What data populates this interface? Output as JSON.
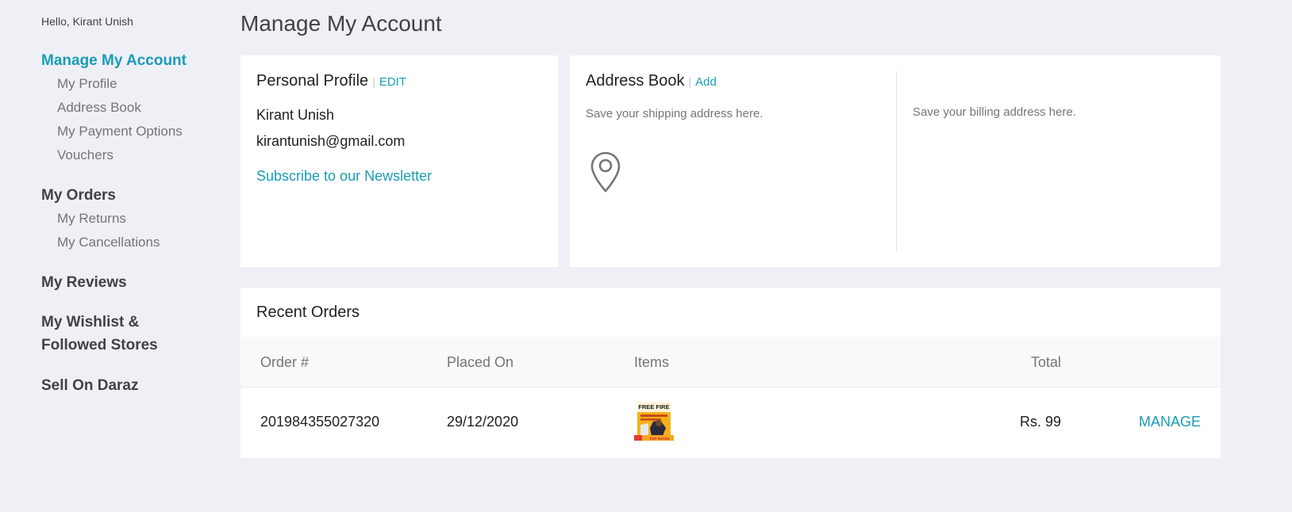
{
  "sidebar": {
    "greeting": "Hello, Kirant Unish",
    "groups": [
      {
        "label": "Manage My Account",
        "items": [
          "My Profile",
          "Address Book",
          "My Payment Options",
          "Vouchers"
        ]
      },
      {
        "label": "My Orders",
        "items": [
          "My Returns",
          "My Cancellations"
        ]
      },
      {
        "label": "My Reviews"
      },
      {
        "label": "My Wishlist &",
        "label2": "Followed Stores"
      },
      {
        "label": "Sell On Daraz"
      }
    ]
  },
  "page": {
    "title": "Manage My Account"
  },
  "profile": {
    "title": "Personal Profile",
    "edit_label": "EDIT",
    "name": "Kirant Unish",
    "email": "kirantunish@gmail.com",
    "newsletter_label": "Subscribe to our Newsletter"
  },
  "address_book": {
    "title": "Address Book",
    "add_label": "Add",
    "shipping_text": "Save your shipping address here.",
    "billing_text": "Save your billing address here.",
    "icon": "location-pin-icon"
  },
  "orders": {
    "title": "Recent Orders",
    "columns": [
      "Order #",
      "Placed On",
      "Items",
      "Total"
    ],
    "rows": [
      {
        "order_no": "201984355027320",
        "placed_on": "29/12/2020",
        "item_thumb_text": "FREE FIRE",
        "item_badge": "TOP RATED",
        "total": "Rs. 99",
        "action": "MANAGE"
      }
    ]
  },
  "colors": {
    "accent": "#1a9cb7",
    "background": "#eff0f5",
    "card": "#ffffff"
  }
}
